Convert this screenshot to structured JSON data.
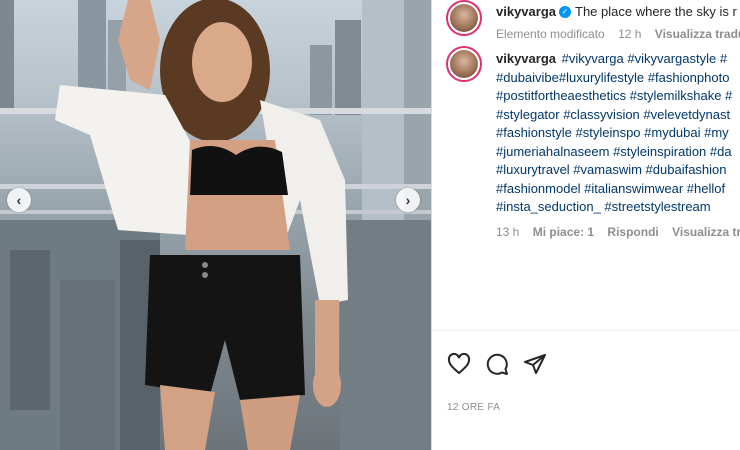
{
  "post": {
    "username": "vikyvarga",
    "caption_text": "The place where the sky is r",
    "edited_label": "Elemento modificato",
    "caption_time": "12 h",
    "translation_label": "Visualizza traduzi"
  },
  "comment": {
    "username": "vikyvarga",
    "hashtag_lines": [
      "#vikyvarga #vikyvargastyle #",
      "#dubaivibe#luxurylifestyle #fashionphoto",
      "#postitfortheaesthetics #stylemilkshake #",
      "#stylegator #classyvision #velevetdynast",
      "#fashionstyle #styleinspo #mydubai #my",
      "#jumeriahalnaseem #styleinspiration #da",
      "#luxurytravel #vamaswim #dubaifashion",
      "#fashionmodel #italianswimwear #hellof",
      "#insta_seduction_ #streetstylestream"
    ],
    "time": "13 h",
    "likes_label": "Mi piace: 1",
    "reply_label": "Rispondi",
    "translation_label": "Visualizza tradu"
  },
  "actions": {
    "like_icon": "heart-icon",
    "comment_icon": "comment-icon",
    "share_icon": "share-icon"
  },
  "footer": {
    "timestamp": "12 ORE FA"
  },
  "carousel": {
    "prev_icon": "chevron-left-icon",
    "next_icon": "chevron-right-icon"
  },
  "colors": {
    "link": "#00376b",
    "muted": "#8e8e8e",
    "verified": "#0095f6"
  }
}
